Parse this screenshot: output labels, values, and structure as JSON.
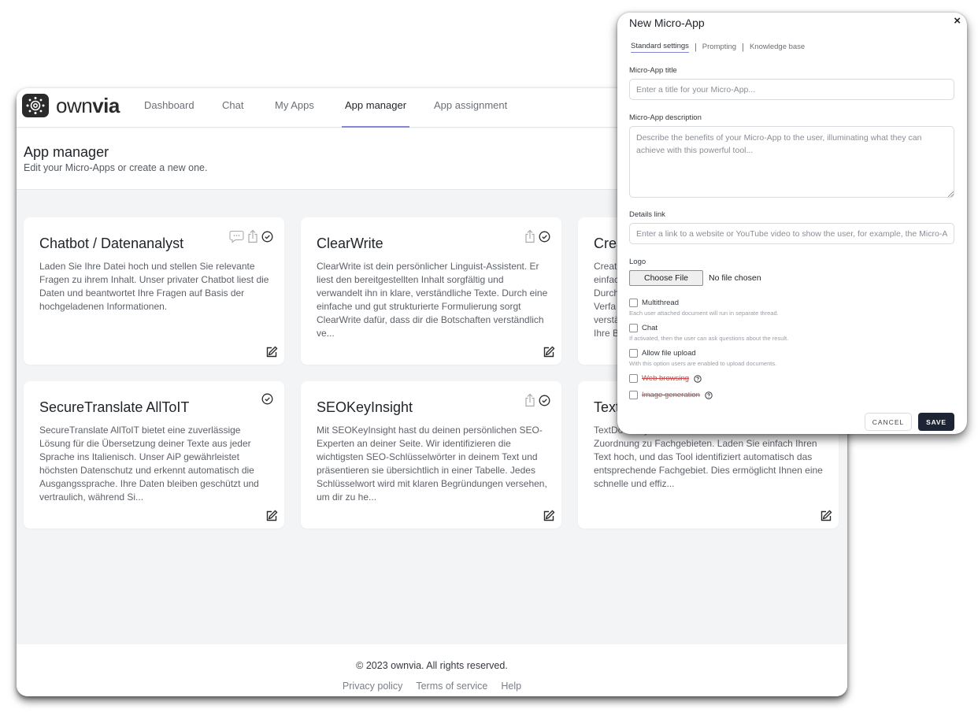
{
  "app": {
    "brand": "ownvia",
    "nav": [
      {
        "label": "Dashboard",
        "active": false
      },
      {
        "label": "Chat",
        "active": false
      },
      {
        "label": "My Apps",
        "active": false
      },
      {
        "label": "App manager",
        "active": true
      },
      {
        "label": "App assignment",
        "active": false
      }
    ],
    "accent_color": "#8a86d6"
  },
  "page": {
    "title": "App manager",
    "subtitle": "Edit your Micro-Apps or create a new one."
  },
  "cards": [
    {
      "title": "Chatbot / Datenanalyst",
      "description": "Laden Sie Ihre Datei hoch und stellen Sie relevante Fragen zu ihrem Inhalt. Unser privater Chatbot liest die Daten und beantwortet Ihre Fragen auf Basis der hochgeladenen Informationen.",
      "icons": [
        "chat-icon",
        "share-icon",
        "check-circle-icon"
      ]
    },
    {
      "title": "ClearWrite",
      "description": "ClearWrite ist dein persönlicher Linguist-Assistent. Er liest den bereitgestellten Inhalt sorgfältig und verwandelt ihn in klare, verständliche Texte. Durch eine einfache und gut strukturierte Formulierung sorgt ClearWrite dafür, dass dir die Botschaften verständlich ve...",
      "icons": [
        "share-icon",
        "check-circle-icon"
      ]
    },
    {
      "title": "Crea",
      "description": "Creat einfac Durch Verfa verstä Ihre B",
      "icons": []
    },
    {
      "title": "SecureTranslate AllToIT",
      "description": "SecureTranslate AllToIT bietet eine zuverlässige Lösung für die Übersetzung deiner Texte aus jeder Sprache ins Italienisch. Unser AiP gewährleistet höchsten Datenschutz und erkennt automatisch die Ausgangssprache. Ihre Daten bleiben geschützt und vertraulich, während Si...",
      "icons": [
        "check-circle-icon"
      ]
    },
    {
      "title": "SEOKeyInsight",
      "description": "Mit SEOKeyInsight hast du deinen persönlichen SEO-Experten an deiner Seite. Wir identifizieren die wichtigsten SEO-Schlüsselwörter in deinem Text und präsentieren sie übersichtlich in einer Tabelle. Jedes Schlüsselwort wird mit klaren Begründungen versehen, um dir zu he...",
      "icons": [
        "share-icon",
        "check-circle-icon"
      ]
    },
    {
      "title": "Text",
      "description": "TextDo Analyse von Texten und zur automatischen Zuordnung zu Fachgebieten. Laden Sie einfach Ihren Text hoch, und das Tool identifiziert automatisch das entsprechende Fachgebiet. Dies ermöglicht Ihnen eine schnelle und effiz...",
      "icons": []
    }
  ],
  "footer": {
    "copyright": "© 2023 ownvia. All rights reserved.",
    "links": [
      "Privacy policy",
      "Terms of service",
      "Help"
    ]
  },
  "modal": {
    "title": "New Micro-App",
    "close": "×",
    "tabs": [
      {
        "label": "Standard settings",
        "active": true
      },
      {
        "label": "Prompting",
        "active": false
      },
      {
        "label": "Knowledge base",
        "active": false
      }
    ],
    "title_field": {
      "label": "Micro-App title",
      "value": "",
      "placeholder": "Enter a title for your Micro-App..."
    },
    "description_field": {
      "label": "Micro-App description",
      "value": "",
      "placeholder": "Describe the benefits of your Micro-App to the user, illuminating what they can achieve with this powerful tool..."
    },
    "details_field": {
      "label": "Details link",
      "value": "",
      "placeholder": "Enter a link to a website or YouTube video to show the user, for example, the Micro-App in action."
    },
    "logo_field": {
      "label": "Logo",
      "button": "Choose File",
      "status": "No file chosen"
    },
    "options": [
      {
        "label": "Multithread",
        "hint": "Each user attached document will run in separate thread.",
        "checked": false,
        "disabled": false
      },
      {
        "label": "Chat",
        "hint": "If activated, then the user can ask questions about the result.",
        "checked": false,
        "disabled": false
      },
      {
        "label": "Allow file upload",
        "hint": "With this option users are enabled to upload documents.",
        "checked": false,
        "disabled": false
      },
      {
        "label": "Web browsing",
        "hint": "",
        "checked": false,
        "disabled": true
      },
      {
        "label": "Image generation",
        "hint": "",
        "checked": false,
        "disabled": true
      }
    ],
    "cancel_label": "CANCEL",
    "save_label": "SAVE",
    "save_color": "#1d2433"
  }
}
